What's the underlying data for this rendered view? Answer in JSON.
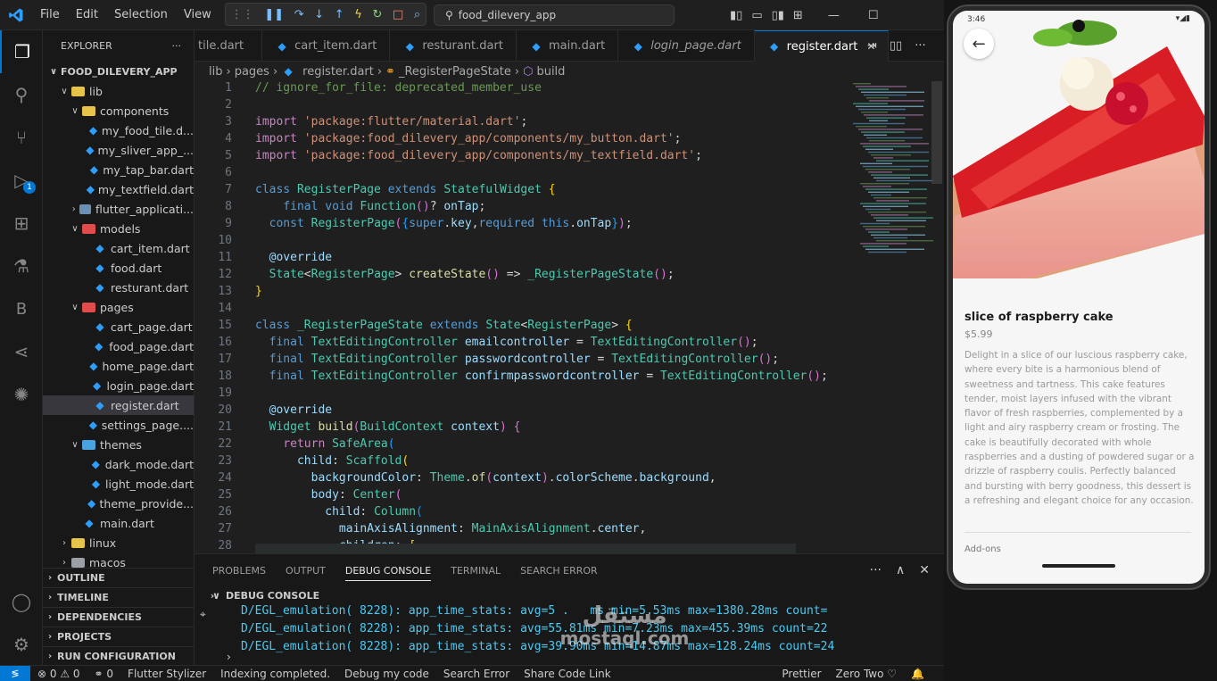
{
  "menu": [
    "File",
    "Edit",
    "Selection",
    "View",
    "···"
  ],
  "search_text": "food_dilevery_app",
  "activity_badge": "1",
  "explorer": {
    "title": "EXPLORER",
    "root": "FOOD_DILEVERY_APP",
    "tree": [
      {
        "label": "lib",
        "depth": 1,
        "type": "folder",
        "color": "#e6c44a",
        "open": true
      },
      {
        "label": "components",
        "depth": 2,
        "type": "folder",
        "color": "#e6c44a",
        "open": true
      },
      {
        "label": "my_food_tile.d...",
        "depth": 3,
        "type": "dart"
      },
      {
        "label": "my_sliver_app_...",
        "depth": 3,
        "type": "dart"
      },
      {
        "label": "my_tap_bar.dart",
        "depth": 3,
        "type": "dart"
      },
      {
        "label": "my_textfield.dart",
        "depth": 3,
        "type": "dart"
      },
      {
        "label": "flutter_applicati...",
        "depth": 2,
        "type": "folder",
        "color": "#6d8fb5",
        "open": false
      },
      {
        "label": "models",
        "depth": 2,
        "type": "folder",
        "color": "#e04b4b",
        "open": true
      },
      {
        "label": "cart_item.dart",
        "depth": 3,
        "type": "dart"
      },
      {
        "label": "food.dart",
        "depth": 3,
        "type": "dart"
      },
      {
        "label": "resturant.dart",
        "depth": 3,
        "type": "dart"
      },
      {
        "label": "pages",
        "depth": 2,
        "type": "folder",
        "color": "#e04b4b",
        "open": true
      },
      {
        "label": "cart_page.dart",
        "depth": 3,
        "type": "dart"
      },
      {
        "label": "food_page.dart",
        "depth": 3,
        "type": "dart"
      },
      {
        "label": "home_page.dart",
        "depth": 3,
        "type": "dart"
      },
      {
        "label": "login_page.dart",
        "depth": 3,
        "type": "dart"
      },
      {
        "label": "register.dart",
        "depth": 3,
        "type": "dart",
        "selected": true
      },
      {
        "label": "settings_page....",
        "depth": 3,
        "type": "dart"
      },
      {
        "label": "themes",
        "depth": 2,
        "type": "folder",
        "color": "#4aa3e0",
        "open": true
      },
      {
        "label": "dark_mode.dart",
        "depth": 3,
        "type": "dart"
      },
      {
        "label": "light_mode.dart",
        "depth": 3,
        "type": "dart"
      },
      {
        "label": "theme_provide...",
        "depth": 3,
        "type": "dart"
      },
      {
        "label": "main.dart",
        "depth": 2,
        "type": "dart"
      },
      {
        "label": "linux",
        "depth": 1,
        "type": "folder",
        "color": "#e6c44a",
        "open": false
      },
      {
        "label": "macos",
        "depth": 1,
        "type": "folder",
        "color": "#9aa0a6",
        "open": false
      }
    ],
    "sections": [
      "OUTLINE",
      "TIMELINE",
      "DEPENDENCIES",
      "PROJECTS",
      "RUN CONFIGURATION"
    ]
  },
  "tabs": [
    {
      "label": "tile.dart",
      "italic": false
    },
    {
      "label": "cart_item.dart",
      "italic": false
    },
    {
      "label": "resturant.dart",
      "italic": false
    },
    {
      "label": "main.dart",
      "italic": false
    },
    {
      "label": "login_page.dart",
      "italic": true
    },
    {
      "label": "register.dart",
      "active": true
    }
  ],
  "breadcrumb": [
    "lib",
    "pages",
    "register.dart",
    "_RegisterPageState",
    "build"
  ],
  "code": [
    {
      "n": "1",
      "html": "<span class='c'>// ignore_for_file: deprecated_member_use</span>"
    },
    {
      "n": "2",
      "html": ""
    },
    {
      "n": "3",
      "html": "<span class='kc'>import</span> <span class='s'>'package:flutter/material.dart'</span>;"
    },
    {
      "n": "4",
      "html": "<span class='kc'>import</span> <span class='s'>'package:food_dilevery_app/components/my_button.dart'</span>;"
    },
    {
      "n": "5",
      "html": "<span class='kc'>import</span> <span class='s'>'package:food_dilevery_app/components/my_textfield.dart'</span>;"
    },
    {
      "n": "6",
      "html": ""
    },
    {
      "n": "7",
      "html": "<span class='k'>class</span> <span class='t'>RegisterPage</span> <span class='k'>extends</span> <span class='t'>StatefulWidget</span> <span class='py'>{</span>"
    },
    {
      "n": "8",
      "html": "    <span class='k'>final</span> <span class='k'>void</span> <span class='t'>Function</span><span class='pp'>()</span>? <span class='v'>onTap</span>;"
    },
    {
      "n": "9",
      "html": "  <span class='k'>const</span> <span class='t'>RegisterPage</span><span class='pp'>(</span><span class='pb'>{</span><span class='k'>super</span>.<span class='v'>key</span>,<span class='k'>required</span> <span class='k'>this</span>.<span class='v'>onTap</span><span class='pb'>}</span><span class='pp'>)</span>;"
    },
    {
      "n": "10",
      "html": ""
    },
    {
      "n": "11",
      "html": "  <span class='v'>@override</span>"
    },
    {
      "n": "12",
      "html": "  <span class='t'>State</span>&lt;<span class='t'>RegisterPage</span>&gt; <span class='f'>createState</span><span class='pp'>()</span> =&gt; <span class='t'>_RegisterPageState</span><span class='pp'>()</span>;"
    },
    {
      "n": "13",
      "html": "<span class='py'>}</span>"
    },
    {
      "n": "14",
      "html": ""
    },
    {
      "n": "15",
      "html": "<span class='k'>class</span> <span class='t'>_RegisterPageState</span> <span class='k'>extends</span> <span class='t'>State</span>&lt;<span class='t'>RegisterPage</span>&gt; <span class='py'>{</span>"
    },
    {
      "n": "16",
      "html": "  <span class='k'>final</span> <span class='t'>TextEditingController</span> <span class='v'>emailcontroller</span> = <span class='t'>TextEditingController</span><span class='pp'>()</span>;"
    },
    {
      "n": "17",
      "html": "  <span class='k'>final</span> <span class='t'>TextEditingController</span> <span class='v'>passwordcontroller</span> = <span class='t'>TextEditingController</span><span class='pp'>()</span>;"
    },
    {
      "n": "18",
      "html": "  <span class='k'>final</span> <span class='t'>TextEditingController</span> <span class='v'>confirmpasswordcontroller</span> = <span class='t'>TextEditingController</span><span class='pp'>()</span>;"
    },
    {
      "n": "19",
      "html": ""
    },
    {
      "n": "20",
      "html": "  <span class='v'>@override</span>"
    },
    {
      "n": "21",
      "html": "  <span class='t'>Widget</span> <span class='f'>build</span><span class='pp'>(</span><span class='t'>BuildContext</span> <span class='v'>context</span><span class='pp'>)</span> <span class='pp'>{</span>"
    },
    {
      "n": "22",
      "html": "    <span class='kc'>return</span> <span class='t'>SafeArea</span><span class='pb'>(</span>"
    },
    {
      "n": "23",
      "html": "      <span class='v'>child</span>: <span class='t'>Scaffold</span><span class='py'>(</span>"
    },
    {
      "n": "24",
      "html": "        <span class='v'>backgroundColor</span>: <span class='t'>Theme</span>.<span class='f'>of</span><span class='pp'>(</span><span class='v'>context</span><span class='pp'>)</span>.<span class='v'>colorScheme</span>.<span class='v'>background</span>,"
    },
    {
      "n": "25",
      "html": "        <span class='v'>body</span>: <span class='t'>Center</span><span class='pp'>(</span>"
    },
    {
      "n": "26",
      "html": "          <span class='v'>child</span>: <span class='t'>Column</span><span class='pb'>(</span>"
    },
    {
      "n": "27",
      "html": "            <span class='v'>mainAxisAlignment</span>: <span class='t'>MainAxisAlignment</span>.<span class='v'>center</span>,"
    },
    {
      "n": "28",
      "html": "            <span class='v'>children</span>: <span class='py'>[</span>"
    }
  ],
  "panel": {
    "tabs": [
      "PROBLEMS",
      "OUTPUT",
      "DEBUG CONSOLE",
      "TERMINAL",
      "SEARCH ERROR"
    ],
    "active_tab": "DEBUG CONSOLE",
    "console_title": "DEBUG CONSOLE",
    "lines": [
      "D/EGL_emulation( 8228): app_time_stats: avg=5 .   ms min=5.53ms max=1380.28ms count=",
      "D/EGL_emulation( 8228): app_time_stats: avg=55.81ms min=7.23ms max=455.39ms count=22",
      "D/EGL_emulation( 8228): app_time_stats: avg=39.90ms min=14.87ms max=128.24ms count=24"
    ]
  },
  "statusbar": {
    "left": [
      "⊗ 0 ⚠ 0",
      "⚭ 0",
      "Flutter Stylizer",
      "Indexing completed.",
      "Debug my code",
      "Search Error",
      "Share Code Link"
    ],
    "right": [
      "Prettier",
      "Zero Two ♡"
    ]
  },
  "phone": {
    "time": "3:46",
    "food_name": "slice of raspberry cake",
    "price": "$5.99",
    "description": "Delight in a slice of our luscious raspberry cake, where every bite is a harmonious blend of sweetness and tartness. This cake features tender, moist layers infused with the vibrant flavor of fresh raspberries, complemented by a light and airy raspberry cream or frosting. The cake is beautifully decorated with whole raspberries and a dusting of powdered sugar or a drizzle of raspberry coulis. Perfectly balanced and bursting with berry goodness, this dessert is a refreshing and elegant choice for any occasion.",
    "addons_label": "Add-ons"
  },
  "watermark": {
    "arabic": "مستقل",
    "latin": "mostaql.com"
  }
}
